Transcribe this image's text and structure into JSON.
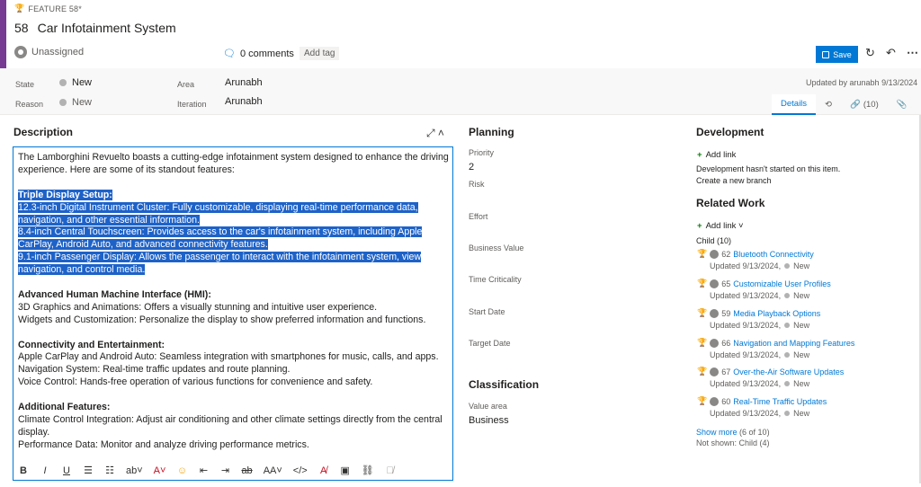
{
  "header": {
    "feature_tag": "FEATURE 58*",
    "id": "58",
    "title": "Car Infotainment System",
    "assignee": "Unassigned",
    "comments": "0 comments",
    "add_tag": "Add tag",
    "save": "Save"
  },
  "fields": {
    "state_label": "State",
    "state_value": "New",
    "reason_label": "Reason",
    "reason_value": "New",
    "area_label": "Area",
    "area_value": "Arunabh",
    "iteration_label": "Iteration",
    "iteration_value": "Arunabh",
    "updated": "Updated by arunabh 9/13/2024"
  },
  "tabs": {
    "details": "Details",
    "links": "(10)"
  },
  "description": {
    "heading": "Description",
    "intro": "The Lamborghini Revuelto boasts a cutting-edge infotainment system designed to enhance the driving experience. Here are some of its standout features:",
    "s1_head": "Triple Display Setup:",
    "s1_l1": "12.3-inch Digital Instrument Cluster: Fully customizable, displaying real-time performance data, navigation, and other essential information.",
    "s1_l2": "8.4-inch Central Touchscreen: Provides access to the car's infotainment system, including Apple CarPlay, Android Auto, and advanced connectivity features.",
    "s1_l3": "9.1-inch Passenger Display: Allows the passenger to interact with the infotainment system, view navigation, and control media.",
    "s2_head": "Advanced Human Machine Interface (HMI):",
    "s2_l1": "3D Graphics and Animations: Offers a visually stunning and intuitive user experience.",
    "s2_l2": "Widgets and Customization: Personalize the display to show preferred information and functions.",
    "s3_head": "Connectivity and Entertainment:",
    "s3_l1": "Apple CarPlay and Android Auto: Seamless integration with smartphones for music, calls, and apps.",
    "s3_l2": "Navigation System: Real-time traffic updates and route planning.",
    "s3_l3": "Voice Control: Hands-free operation of various functions for convenience and safety.",
    "s4_head": "Additional Features:",
    "s4_l1": "Climate Control Integration: Adjust air conditioning and other climate settings directly from the central display.",
    "s4_l2": "Performance Data: Monitor and analyze driving performance metrics."
  },
  "planning": {
    "heading": "Planning",
    "priority_label": "Priority",
    "priority_value": "2",
    "risk_label": "Risk",
    "effort_label": "Effort",
    "business_value_label": "Business Value",
    "time_criticality_label": "Time Criticality",
    "start_date_label": "Start Date",
    "target_date_label": "Target Date"
  },
  "classification": {
    "heading": "Classification",
    "value_area_label": "Value area",
    "value_area_value": "Business"
  },
  "development": {
    "heading": "Development",
    "add_link": "Add link",
    "note": "Development hasn't started on this item.",
    "create_branch": "Create a new branch"
  },
  "related": {
    "heading": "Related Work",
    "add_link": "Add link",
    "child_label": "Child (10)",
    "items": [
      {
        "id": "62",
        "title": "Bluetooth Connectivity",
        "updated": "Updated 9/13/2024,",
        "state": "New"
      },
      {
        "id": "65",
        "title": "Customizable User Profiles",
        "updated": "Updated 9/13/2024,",
        "state": "New"
      },
      {
        "id": "59",
        "title": "Media Playback Options",
        "updated": "Updated 9/13/2024,",
        "state": "New"
      },
      {
        "id": "66",
        "title": "Navigation and Mapping Features",
        "updated": "Updated 9/13/2024,",
        "state": "New"
      },
      {
        "id": "67",
        "title": "Over-the-Air Software Updates",
        "updated": "Updated 9/13/2024,",
        "state": "New"
      },
      {
        "id": "60",
        "title": "Real-Time Traffic Updates",
        "updated": "Updated 9/13/2024,",
        "state": "New"
      }
    ],
    "show_more": "Show more",
    "show_more_count": "(6 of 10)",
    "not_shown": "Not shown: Child (4)"
  },
  "colors": {
    "accent": "#773b93",
    "primary": "#0078d4",
    "highlight": "#1e62c8"
  }
}
